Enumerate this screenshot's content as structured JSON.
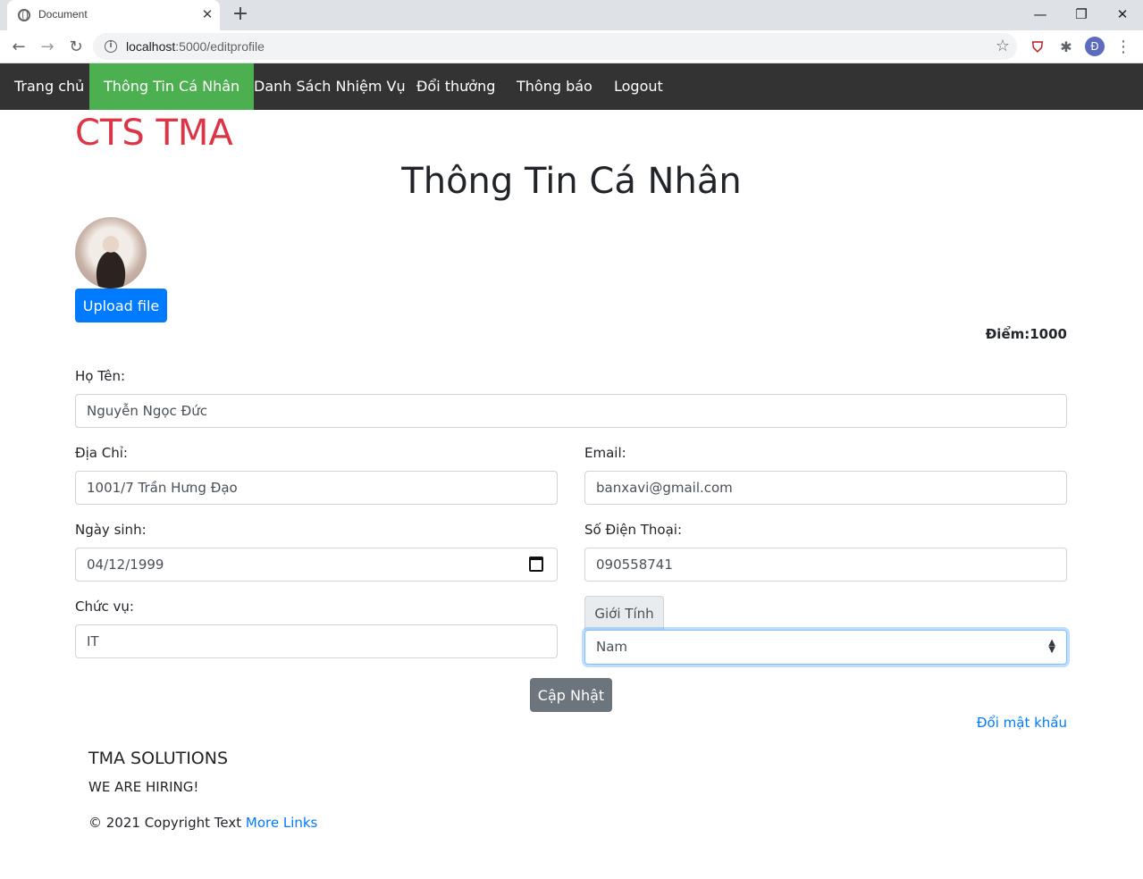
{
  "browser": {
    "tab_title": "Document",
    "tab_close": "✕",
    "new_tab": "+",
    "url_host": "localhost",
    "url_rest": ":5000/editprofile",
    "profile_initial": "Đ",
    "window_controls": {
      "minimize": "—",
      "restore": "❐",
      "close": "✕"
    }
  },
  "nav": {
    "items": [
      {
        "label": "Trang chủ"
      },
      {
        "label": "Thông Tin Cá Nhân",
        "active": true
      },
      {
        "label": "Danh Sách Nhiệm Vụ"
      },
      {
        "label": "Đổi thưởng"
      },
      {
        "label": "Thông báo"
      },
      {
        "label": "Logout"
      }
    ]
  },
  "page": {
    "brand": "CTS TMA",
    "title": "Thông Tin Cá Nhân",
    "upload_label": "Upload file",
    "points": "Điểm:1000"
  },
  "form": {
    "name_label": "Họ Tên:",
    "name_value": "Nguyễn Ngọc Đức",
    "address_label": "Địa Chỉ:",
    "address_value": "1001/7 Trần Hưng Đạo",
    "email_label": "Email:",
    "email_value": "banxavi@gmail.com",
    "dob_label": "Ngày sinh:",
    "dob_value": "04/12/1999",
    "phone_label": "Số Điện Thoại:",
    "phone_value": "090558741",
    "position_label": "Chức vụ:",
    "position_value": "IT",
    "gender_label": "Giới Tính",
    "gender_value": "Nam",
    "submit_label": "Cập Nhật",
    "change_password": "Đổi mật khẩu"
  },
  "footer": {
    "title": "TMA SOLUTIONS",
    "hiring": "WE ARE HIRING!",
    "copyright": "© 2021 Copyright Text",
    "more_links": "More Links"
  },
  "colors": {
    "brand": "#dc3545",
    "nav_bg": "#333333",
    "nav_active": "#4caf50",
    "primary": "#007bff",
    "secondary": "#6c757d"
  }
}
